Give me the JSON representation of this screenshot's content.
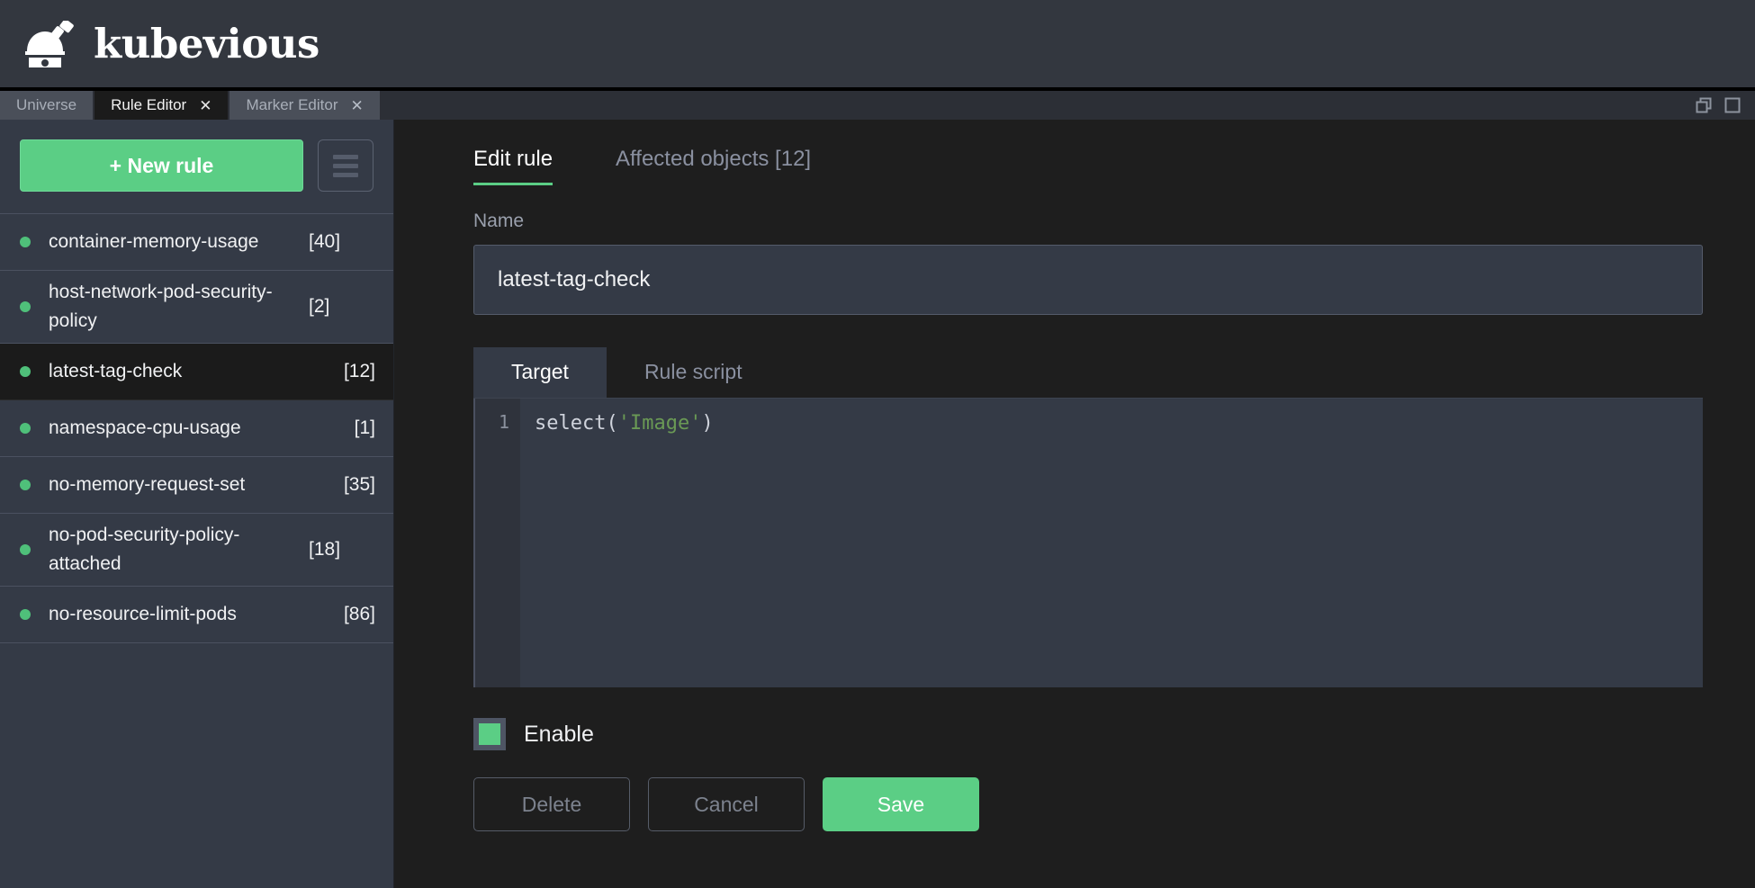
{
  "app": {
    "brand": "kubevious",
    "logo_icon": "observatory-dome-icon"
  },
  "tabstrip": {
    "tabs": [
      {
        "label": "Universe",
        "active": false,
        "closable": false
      },
      {
        "label": "Rule Editor",
        "active": true,
        "closable": true,
        "close_icon": "close-icon"
      },
      {
        "label": "Marker Editor",
        "active": false,
        "closable": true,
        "close_icon": "close-icon"
      }
    ],
    "window_controls": [
      {
        "icon": "restore-windows-icon"
      },
      {
        "icon": "maximize-window-icon"
      }
    ]
  },
  "sidebar": {
    "new_rule_label": "+ New rule",
    "menu_icon": "hamburger-menu-icon",
    "rules": [
      {
        "name": "container-memory-usage",
        "count": "[40]",
        "status": "enabled",
        "selected": false
      },
      {
        "name": "host-network-pod-security-policy",
        "count": "[2]",
        "status": "enabled",
        "selected": false
      },
      {
        "name": "latest-tag-check",
        "count": "[12]",
        "status": "enabled",
        "selected": true
      },
      {
        "name": "namespace-cpu-usage",
        "count": "[1]",
        "status": "enabled",
        "selected": false
      },
      {
        "name": "no-memory-request-set",
        "count": "[35]",
        "status": "enabled",
        "selected": false
      },
      {
        "name": "no-pod-security-policy-attached",
        "count": "[18]",
        "status": "enabled",
        "selected": false
      },
      {
        "name": "no-resource-limit-pods",
        "count": "[86]",
        "status": "enabled",
        "selected": false
      }
    ]
  },
  "main": {
    "tabs": [
      {
        "label": "Edit rule",
        "active": true
      },
      {
        "label": "Affected objects [12]",
        "active": false
      }
    ],
    "name_label": "Name",
    "name_value": "latest-tag-check",
    "name_placeholder": "Rule name",
    "editor_tabs": [
      {
        "label": "Target",
        "active": true
      },
      {
        "label": "Rule script",
        "active": false
      }
    ],
    "code": {
      "line_number": "1",
      "fn": "select(",
      "string": "'Image'",
      "close": ")"
    },
    "enable_label": "Enable",
    "enable_checked": true,
    "buttons": {
      "delete": "Delete",
      "cancel": "Cancel",
      "save": "Save"
    }
  },
  "colors": {
    "accent_green": "#5bce85",
    "header_bg": "#33373f",
    "sidebar_bg": "#343a46",
    "main_bg": "#1e1e1e",
    "selected_bg": "#1b1b1b",
    "string_token": "#6a9955"
  }
}
